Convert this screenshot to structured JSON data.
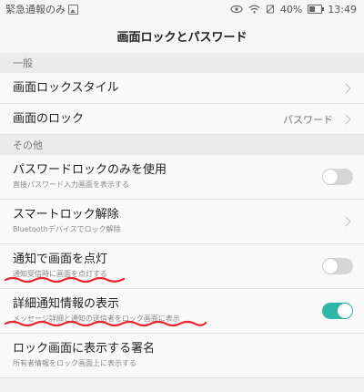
{
  "statusbar": {
    "left_text": "緊急通報のみ",
    "battery": "40%",
    "time": "13:49"
  },
  "titlebar": {
    "title": "画面ロックとパスワード"
  },
  "sections": [
    {
      "header": "一般",
      "items": [
        {
          "title": "画面ロックスタイル",
          "type": "chevron"
        },
        {
          "title": "画面のロック",
          "value": "パスワード",
          "type": "chevron"
        }
      ]
    },
    {
      "header": "その他",
      "items": [
        {
          "title": "パスワードロックのみを使用",
          "subtitle": "直接パスワード入力画面を表示する",
          "type": "toggle",
          "on": false
        },
        {
          "title": "スマートロック解除",
          "subtitle": "Bluetoothデバイスでロック解除",
          "type": "chevron"
        },
        {
          "title": "通知で画面を点灯",
          "subtitle": "通知受信時に画面を点灯する",
          "type": "toggle",
          "on": false
        },
        {
          "title": "詳細通知情報の表示",
          "subtitle": "メッセージ詳細と通知の送信者をロック画面に表示",
          "type": "toggle",
          "on": true
        },
        {
          "title": "ロック画面に表示する署名",
          "subtitle": "所有者情報をロック画面上に表示する",
          "type": "none"
        }
      ]
    }
  ],
  "colors": {
    "toggle_on": "#2fb6a8",
    "toggle_off": "#d6d6d6",
    "annotation": "#e8262f"
  }
}
